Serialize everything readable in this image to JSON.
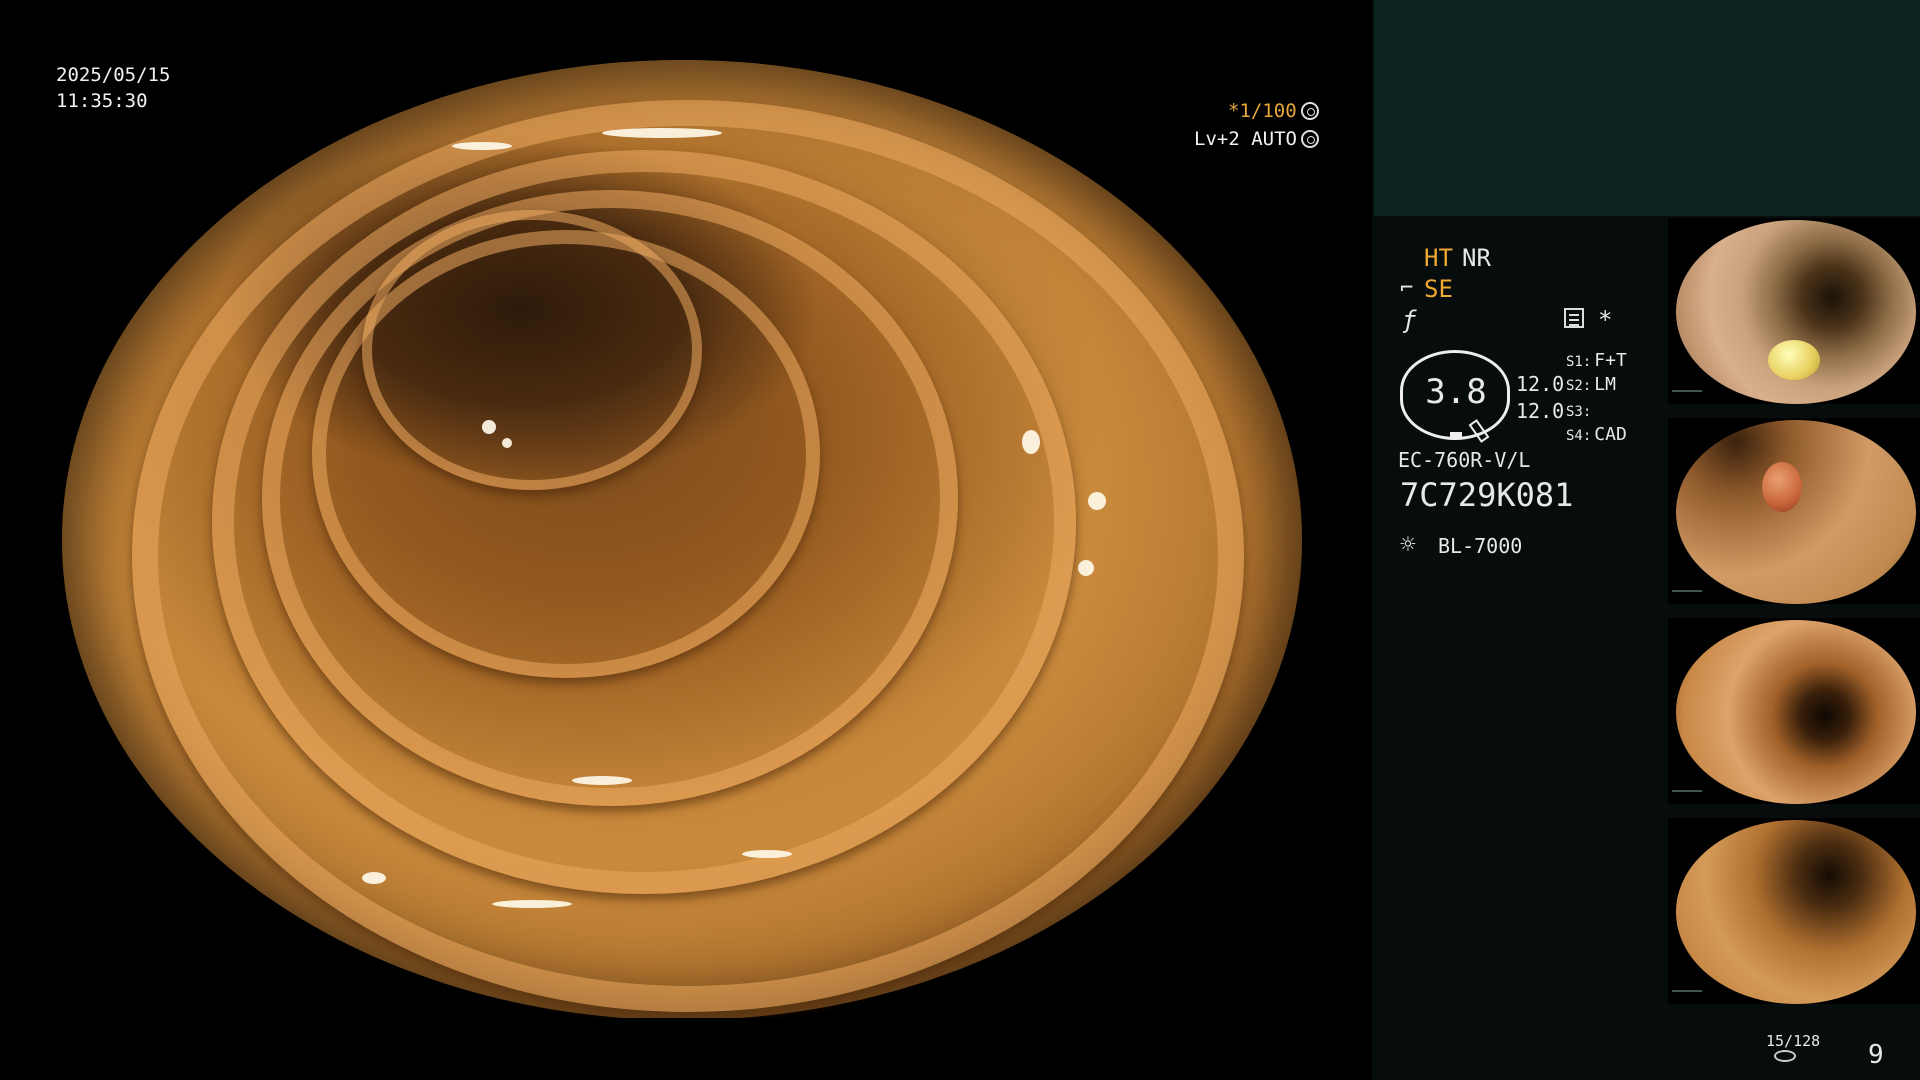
{
  "osd": {
    "date": "2025/05/15",
    "time": "11:35:30",
    "exposure": "*1/100",
    "mode": "Lv+2 AUTO"
  },
  "panel": {
    "ht": "HT",
    "nr": "NR",
    "se": "SE",
    "star": "*",
    "ring_value": "3.8",
    "value_a": "12.0",
    "value_b": "12.0",
    "s_labels": [
      "S1:",
      "S2:",
      "S3:",
      "S4:"
    ],
    "s_values": [
      "F+T",
      "LM",
      "",
      "CAD"
    ],
    "scope_model": "EC-760R-V/L",
    "scope_serial": "7C729K081",
    "light_source": "BL-7000",
    "page_count": "15/128",
    "image_index": "9"
  },
  "thumbnails": [
    {
      "name": "thumbnail-1",
      "finding": "polyp"
    },
    {
      "name": "thumbnail-2",
      "finding": "polyp"
    },
    {
      "name": "thumbnail-3",
      "finding": ""
    },
    {
      "name": "thumbnail-4",
      "finding": ""
    }
  ],
  "colors": {
    "panel_bg": "#060d0c",
    "panel_top_bg": "#0e2421",
    "accent_orange": "#f0a831",
    "mucosa": "#c98a3c"
  }
}
